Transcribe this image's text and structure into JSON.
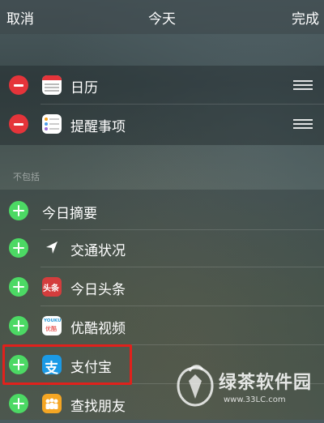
{
  "header": {
    "cancel_label": "取消",
    "title": "今天",
    "done_label": "完成"
  },
  "included": [
    {
      "label": "日历",
      "icon": "calendar-icon"
    },
    {
      "label": "提醒事项",
      "icon": "reminders-icon"
    }
  ],
  "excluded_section_label": "不包括",
  "excluded": [
    {
      "label": "今日摘要",
      "icon": ""
    },
    {
      "label": "交通状况",
      "icon": "location-arrow-icon"
    },
    {
      "label": "今日头条",
      "icon": "toutiao-icon",
      "icon_text": "头条"
    },
    {
      "label": "优酷视频",
      "icon": "youku-icon",
      "icon_text_top": "YOUKU",
      "icon_text_bottom": "优酷"
    },
    {
      "label": "支付宝",
      "icon": "alipay-icon",
      "icon_text": "支"
    },
    {
      "label": "查找朋友",
      "icon": "find-friends-icon"
    }
  ],
  "watermark": {
    "brand": "绿茶软件园",
    "url": "www.33LC.com"
  },
  "colors": {
    "remove": "#e5343a",
    "add": "#4cd964",
    "highlight": "#e0211c"
  }
}
